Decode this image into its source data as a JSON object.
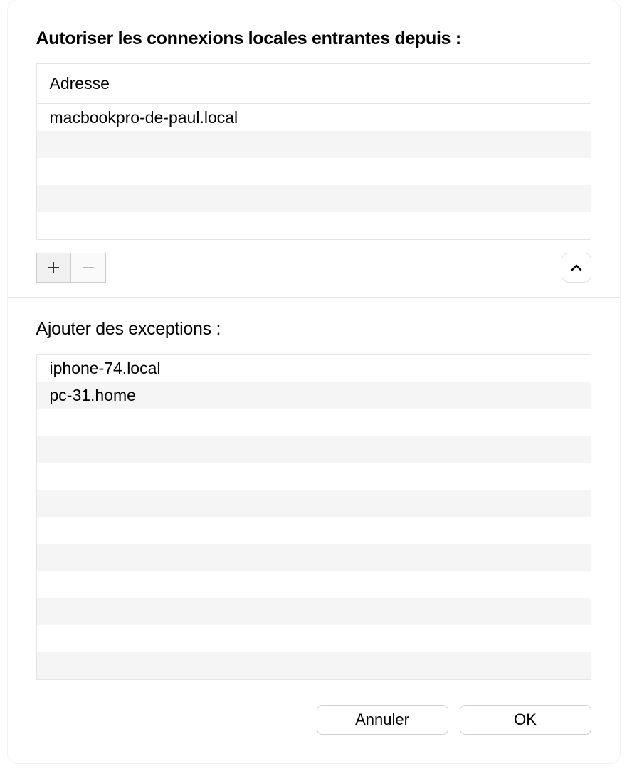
{
  "allow_section": {
    "title": "Autoriser les connexions locales entrantes depuis :",
    "header": "Adresse",
    "rows": [
      "macbookpro-de-paul.local",
      "",
      "",
      "",
      ""
    ]
  },
  "exceptions_section": {
    "title": "Ajouter des exceptions :",
    "rows": [
      "iphone-74.local",
      "pc-31.home",
      "",
      "",
      "",
      "",
      "",
      "",
      "",
      "",
      "",
      ""
    ]
  },
  "buttons": {
    "cancel": "Annuler",
    "ok": "OK"
  }
}
